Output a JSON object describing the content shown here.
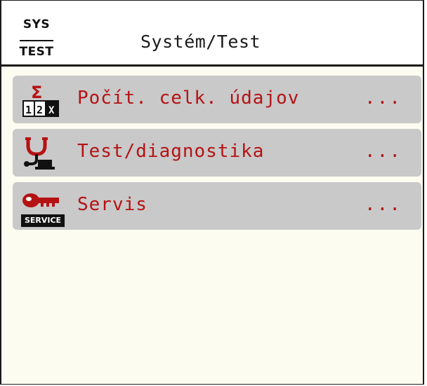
{
  "header": {
    "badge_top": "SYS",
    "badge_bottom": "TEST",
    "title": "Systém/Test"
  },
  "menu": {
    "items": [
      {
        "label": "Počít. celk. údajov",
        "more": "...",
        "icon": "sigma-counter-icon"
      },
      {
        "label": "Test/diagnostika",
        "more": "...",
        "icon": "diagnostic-icon"
      },
      {
        "label": "Servis",
        "more": "...",
        "icon": "service-key-icon",
        "tag": "SERVICE"
      }
    ]
  },
  "colors": {
    "item_bg": "#c9c9c9",
    "label_red": "#b51214",
    "screen_bg": "#fdfcf1"
  }
}
